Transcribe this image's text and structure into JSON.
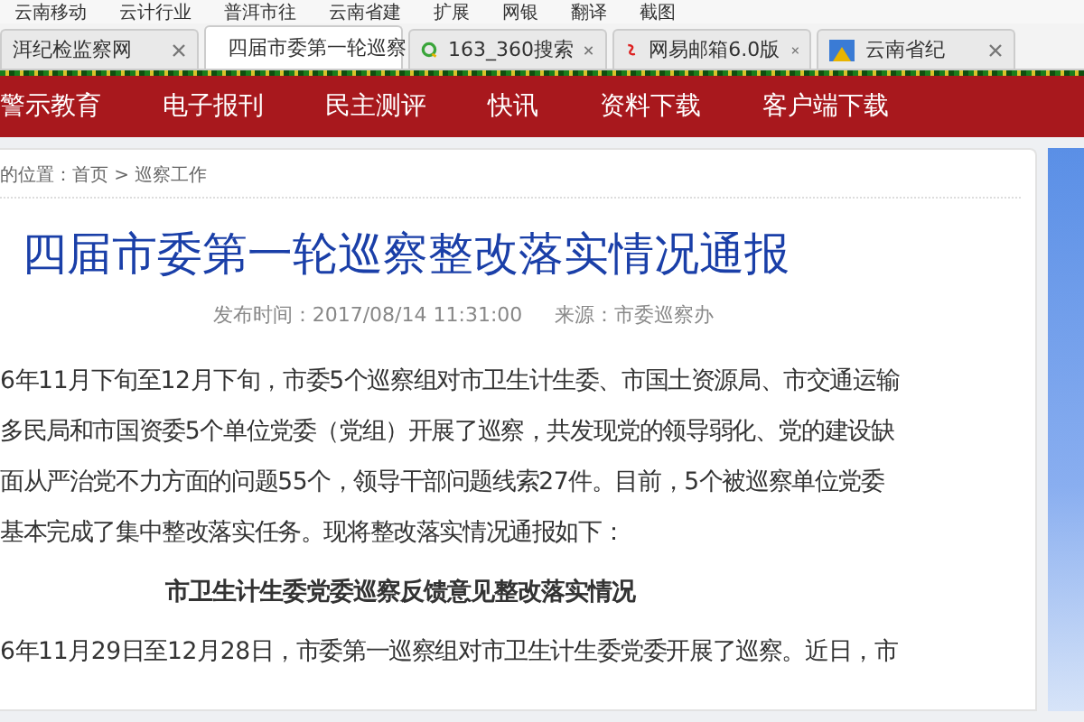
{
  "bookmarks": [
    "云南移动",
    "云计行业",
    "普洱市往",
    "云南省建",
    "扩展",
    "网银",
    "翻译",
    "截图"
  ],
  "tabs": [
    {
      "label": "洱纪检监察网",
      "selected": false
    },
    {
      "label": "四届市委第一轮巡察",
      "selected": true
    },
    {
      "label": "163_360搜索",
      "selected": false
    },
    {
      "label": "网易邮箱6.0版",
      "selected": false
    },
    {
      "label": "云南省纪",
      "selected": false
    }
  ],
  "nav": [
    "警示教育",
    "电子报刊",
    "民主测评",
    "快讯",
    "资料下载",
    "客户端下载"
  ],
  "breadcrumb": "的位置：首页 > 巡察工作",
  "article": {
    "title": "四届市委第一轮巡察整改落实情况通报",
    "published": "发布时间：2017/08/14 11:31:00",
    "source": "来源：市委巡察办",
    "blocks": [
      {
        "kind": "line",
        "text": "6年11月下旬至12月下旬，市委5个巡察组对市卫生计生委、市国土资源局、市交通运输"
      },
      {
        "kind": "line",
        "text": "多民局和市国资委5个单位党委（党组）开展了巡察，共发现党的领导弱化、党的建设缺"
      },
      {
        "kind": "line",
        "text": "面从严治党不力方面的问题55个，领导干部问题线索27件。目前，5个被巡察单位党委"
      },
      {
        "kind": "line",
        "text": "基本完成了集中整改落实任务。现将整改落实情况通报如下："
      },
      {
        "kind": "heading",
        "text": "市卫生计生委党委巡察反馈意见整改落实情况"
      },
      {
        "kind": "line",
        "text": "6年11月29日至12月28日，市委第一巡察组对市卫生计生委党委开展了巡察。近日，市"
      }
    ]
  }
}
